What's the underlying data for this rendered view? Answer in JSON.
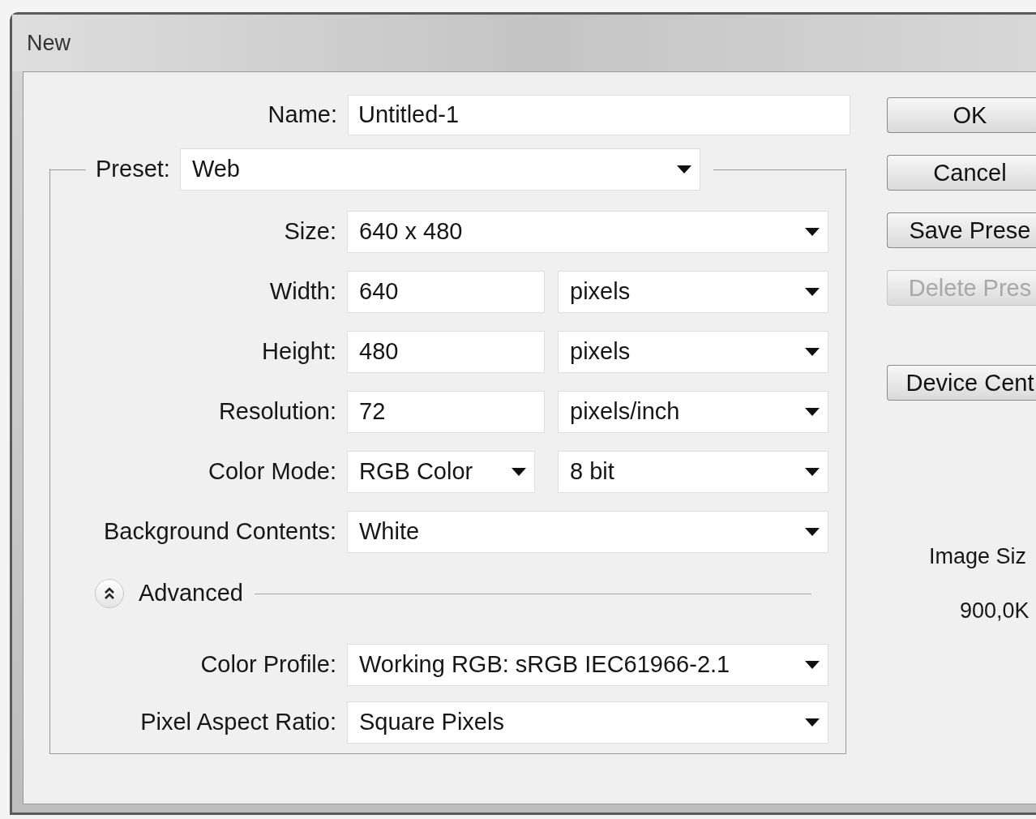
{
  "window": {
    "title": "New"
  },
  "name": {
    "label": "Name:",
    "value": "Untitled-1"
  },
  "preset": {
    "label": "Preset:",
    "value": "Web"
  },
  "fields": [
    {
      "kind": "select",
      "label": "Size:",
      "value": "640 x 480"
    },
    {
      "kind": "input_unit",
      "label": "Width:",
      "value": "640",
      "unit": "pixels"
    },
    {
      "kind": "input_unit",
      "label": "Height:",
      "value": "480",
      "unit": "pixels"
    },
    {
      "kind": "input_unit",
      "label": "Resolution:",
      "value": "72",
      "unit": "pixels/inch"
    },
    {
      "kind": "select_pair",
      "label": "Color Mode:",
      "value": "RGB Color",
      "unit": "8 bit"
    },
    {
      "kind": "select",
      "label": "Background Contents:",
      "value": "White"
    }
  ],
  "advanced": {
    "label": "Advanced",
    "expanded": true,
    "fields": [
      {
        "kind": "select",
        "label": "Color Profile:",
        "value": "Working RGB:  sRGB IEC61966-2.1"
      },
      {
        "kind": "select",
        "label": "Pixel Aspect Ratio:",
        "value": "Square Pixels"
      }
    ]
  },
  "buttons": [
    {
      "label": "OK",
      "disabled": false
    },
    {
      "label": "Cancel",
      "disabled": false
    },
    {
      "label": "Save Prese",
      "disabled": false
    },
    {
      "label": "Delete Pres",
      "disabled": true
    }
  ],
  "side_button": {
    "label": "Device Cent",
    "disabled": false
  },
  "image_size": {
    "label": "Image Siz",
    "value": "900,0K"
  }
}
